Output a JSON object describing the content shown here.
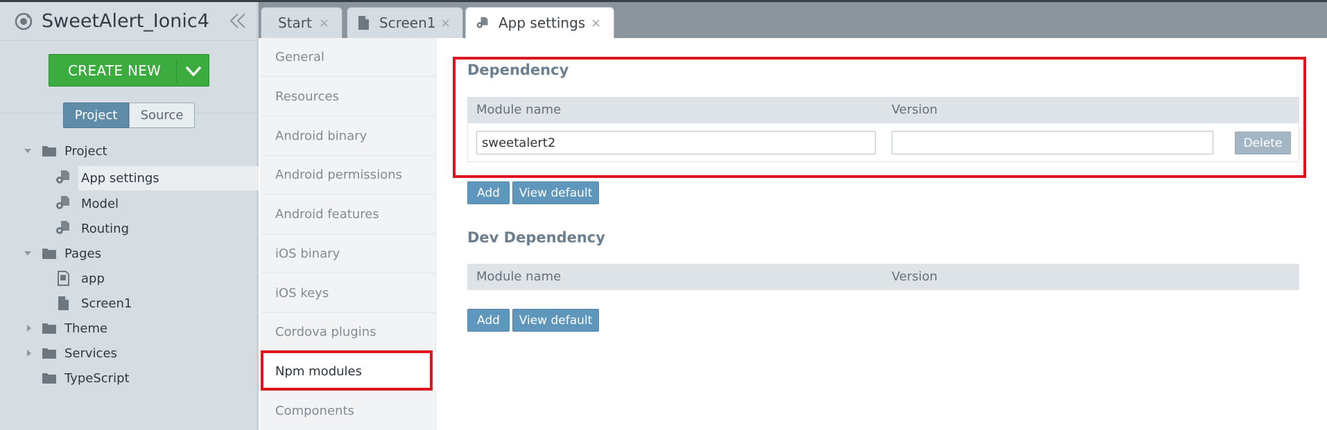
{
  "app": {
    "title": "SweetAlert_Ionic4"
  },
  "sidebar": {
    "create_label": "CREATE NEW",
    "toggle": {
      "project": "Project",
      "source": "Source"
    },
    "tree": [
      {
        "label": "Project",
        "type": "folder",
        "expanded": true
      },
      {
        "label": "App settings",
        "type": "settings",
        "selected": true
      },
      {
        "label": "Model",
        "type": "settings"
      },
      {
        "label": "Routing",
        "type": "settings"
      },
      {
        "label": "Pages",
        "type": "folder",
        "expanded": true
      },
      {
        "label": "app",
        "type": "page"
      },
      {
        "label": "Screen1",
        "type": "file"
      },
      {
        "label": "Theme",
        "type": "folder",
        "expanded": false
      },
      {
        "label": "Services",
        "type": "folder",
        "expanded": false
      },
      {
        "label": "TypeScript",
        "type": "folder"
      }
    ]
  },
  "tabs": [
    {
      "label": "Start",
      "close": "×"
    },
    {
      "label": "Screen1",
      "close": "×"
    },
    {
      "label": "App settings",
      "close": "×",
      "active": true
    }
  ],
  "settings_nav": [
    {
      "label": "General"
    },
    {
      "label": "Resources"
    },
    {
      "label": "Android binary"
    },
    {
      "label": "Android permissions"
    },
    {
      "label": "Android features"
    },
    {
      "label": "iOS binary"
    },
    {
      "label": "iOS keys"
    },
    {
      "label": "Cordova plugins"
    },
    {
      "label": "Npm modules",
      "active": true
    },
    {
      "label": "Components"
    }
  ],
  "dependency": {
    "title": "Dependency",
    "columns": {
      "module": "Module name",
      "version": "Version"
    },
    "rows": [
      {
        "module": "sweetalert2",
        "version": "",
        "delete_label": "Delete"
      }
    ],
    "add_label": "Add",
    "view_default_label": "View default"
  },
  "dev_dependency": {
    "title": "Dev Dependency",
    "columns": {
      "module": "Module name",
      "version": "Version"
    },
    "add_label": "Add",
    "view_default_label": "View default"
  },
  "colors": {
    "accent_green": "#3cac3f",
    "accent_blue": "#5e97bb",
    "highlight_red": "#e0141e"
  }
}
